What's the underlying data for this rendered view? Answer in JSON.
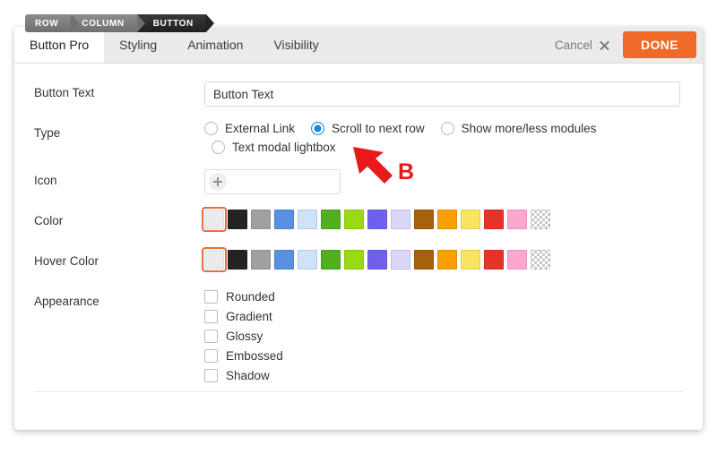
{
  "breadcrumb": {
    "items": [
      {
        "label": "ROW",
        "active": false
      },
      {
        "label": "COLUMN",
        "active": false
      },
      {
        "label": "BUTTON",
        "active": true
      }
    ]
  },
  "header": {
    "tabs": [
      {
        "label": "Button Pro",
        "active": true
      },
      {
        "label": "Styling",
        "active": false
      },
      {
        "label": "Animation",
        "active": false
      },
      {
        "label": "Visibility",
        "active": false
      }
    ],
    "cancel_label": "Cancel",
    "cancel_icon": "close-x-icon",
    "done_label": "DONE",
    "done_color": "#ef6a28"
  },
  "form": {
    "button_text": {
      "label": "Button Text",
      "value": "Button Text",
      "placeholder": ""
    },
    "type": {
      "label": "Type",
      "options": [
        {
          "label": "External Link",
          "checked": false
        },
        {
          "label": "Scroll to next row",
          "checked": true
        },
        {
          "label": "Show more/less modules",
          "checked": false
        },
        {
          "label": "Text modal lightbox",
          "checked": false
        }
      ],
      "selected": "Scroll to next row",
      "accent_color": "#1a87d8"
    },
    "icon": {
      "label": "Icon",
      "add_icon": "plus-icon",
      "value": ""
    },
    "color": {
      "label": "Color",
      "selected_index": 0,
      "selection_color": "#e2703a",
      "swatches": [
        {
          "name": "white",
          "hex": "#ebebeb"
        },
        {
          "name": "black",
          "hex": "#232323"
        },
        {
          "name": "gray",
          "hex": "#a0a0a0"
        },
        {
          "name": "blue",
          "hex": "#5b8fe0"
        },
        {
          "name": "light-blue",
          "hex": "#cfe2fa"
        },
        {
          "name": "green",
          "hex": "#51b01f"
        },
        {
          "name": "lime",
          "hex": "#9ad914"
        },
        {
          "name": "purple",
          "hex": "#7061ec"
        },
        {
          "name": "lavender",
          "hex": "#dcd6fa"
        },
        {
          "name": "brown",
          "hex": "#a6610a"
        },
        {
          "name": "orange",
          "hex": "#faa004"
        },
        {
          "name": "yellow",
          "hex": "#fae45f"
        },
        {
          "name": "red",
          "hex": "#e6332a"
        },
        {
          "name": "pink",
          "hex": "#fba7cf"
        },
        {
          "name": "transparent",
          "hex": "transparent"
        }
      ]
    },
    "hover_color": {
      "label": "Hover Color",
      "selected_index": 0,
      "selection_color": "#e2703a",
      "swatches": [
        {
          "name": "white",
          "hex": "#ebebeb"
        },
        {
          "name": "black",
          "hex": "#232323"
        },
        {
          "name": "gray",
          "hex": "#a0a0a0"
        },
        {
          "name": "blue",
          "hex": "#5b8fe0"
        },
        {
          "name": "light-blue",
          "hex": "#cfe2fa"
        },
        {
          "name": "green",
          "hex": "#51b01f"
        },
        {
          "name": "lime",
          "hex": "#9ad914"
        },
        {
          "name": "purple",
          "hex": "#7061ec"
        },
        {
          "name": "lavender",
          "hex": "#dcd6fa"
        },
        {
          "name": "brown",
          "hex": "#a6610a"
        },
        {
          "name": "orange",
          "hex": "#faa004"
        },
        {
          "name": "yellow",
          "hex": "#fae45f"
        },
        {
          "name": "red",
          "hex": "#e6332a"
        },
        {
          "name": "pink",
          "hex": "#fba7cf"
        },
        {
          "name": "transparent",
          "hex": "transparent"
        }
      ]
    },
    "appearance": {
      "label": "Appearance",
      "options": [
        {
          "label": "Rounded",
          "checked": false
        },
        {
          "label": "Gradient",
          "checked": false
        },
        {
          "label": "Glossy",
          "checked": false
        },
        {
          "label": "Embossed",
          "checked": false
        },
        {
          "label": "Shadow",
          "checked": false
        }
      ]
    }
  },
  "annotation": {
    "letter": "B",
    "color": "#e8181b",
    "arrow_icon": "arrow-up-left-icon"
  }
}
